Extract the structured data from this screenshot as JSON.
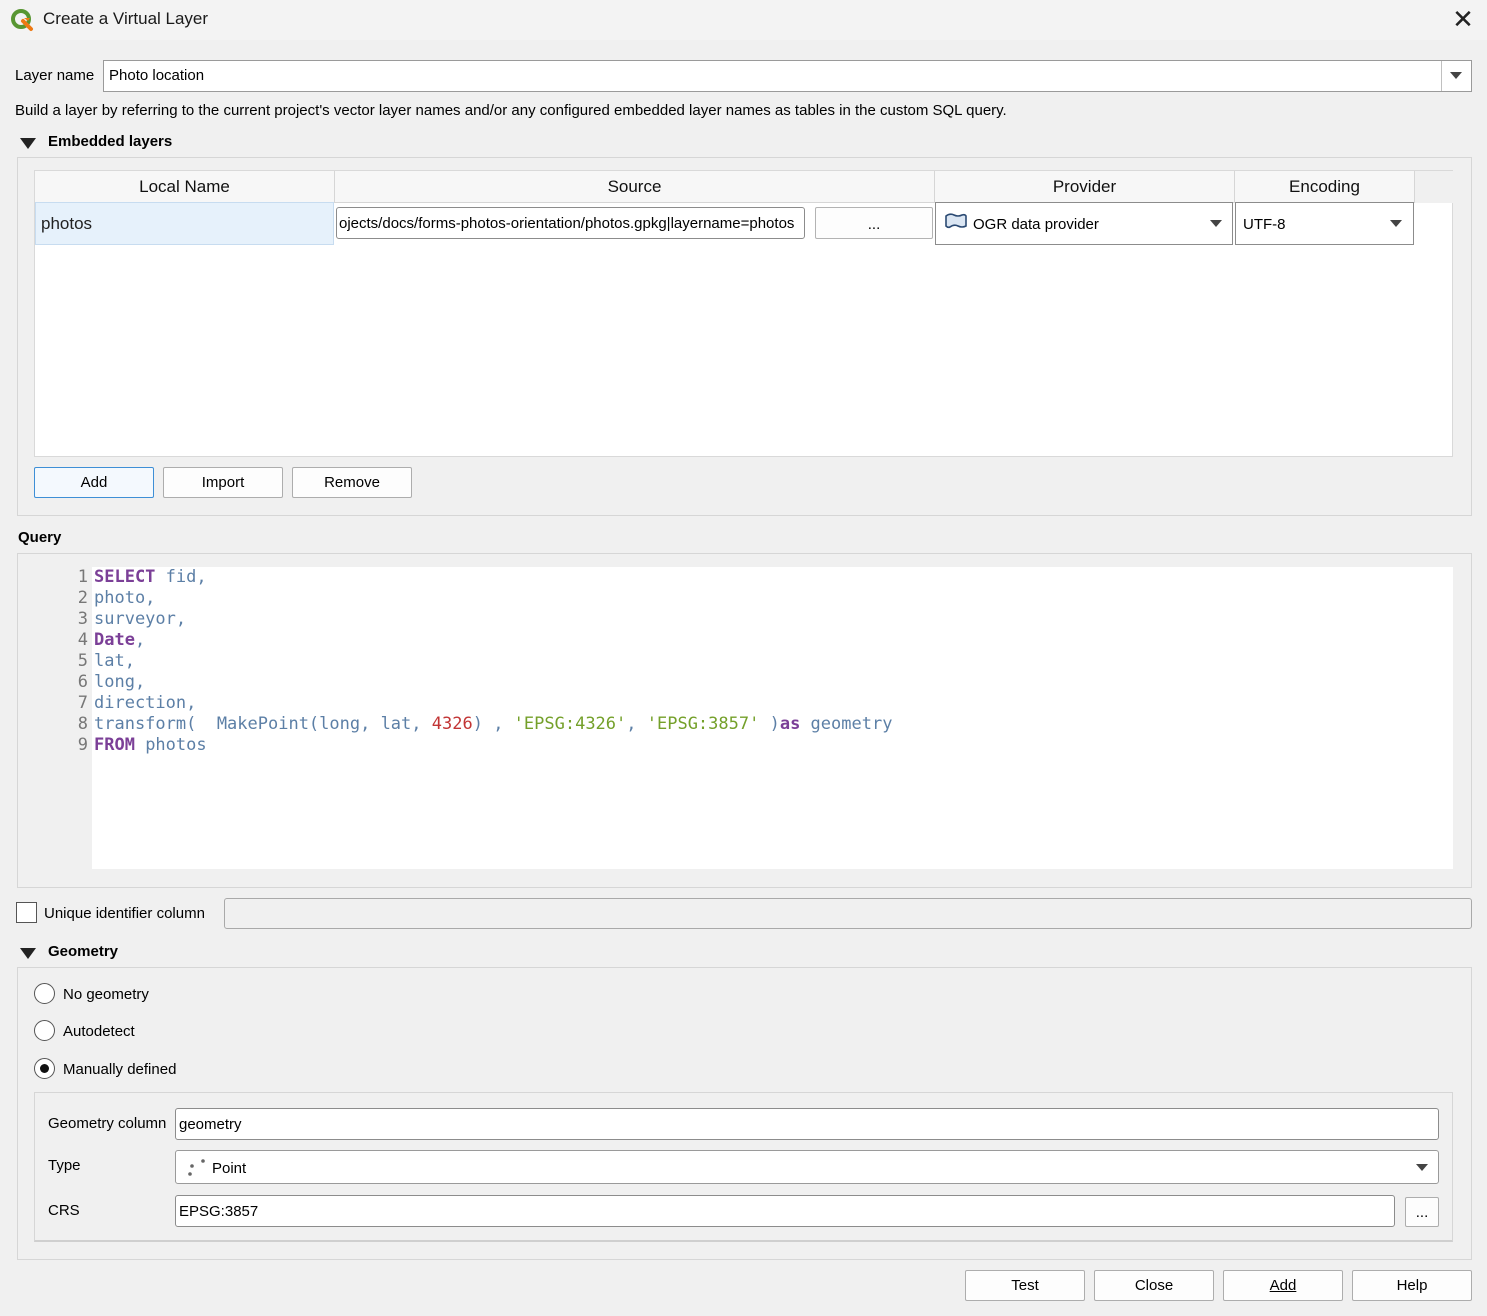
{
  "window": {
    "title": "Create a Virtual Layer",
    "close_symbol": "✕"
  },
  "layer_name": {
    "label": "Layer name",
    "value": "Photo location"
  },
  "description": "Build a layer by referring to the current project's vector layer names and/or any configured embedded layer names as tables in the custom SQL query.",
  "embedded_layers": {
    "title": "Embedded layers",
    "columns": [
      "Local Name",
      "Source",
      "Provider",
      "Encoding"
    ],
    "rows": [
      {
        "local_name": "photos",
        "source": "ojects/docs/forms-photos-orientation/photos.gpkg|layername=photos",
        "browse_label": "...",
        "provider": "OGR data provider",
        "encoding": "UTF-8"
      }
    ],
    "buttons": {
      "add": "Add",
      "import": "Import",
      "remove": "Remove"
    }
  },
  "query": {
    "title": "Query",
    "line_numbers": [
      "1",
      "2",
      "3",
      "4",
      "5",
      "6",
      "7",
      "8",
      "9"
    ],
    "tokens": {
      "l1_kw": "SELECT",
      "l1_rest": " fid,",
      "l2": "photo,",
      "l3": "surveyor,",
      "l4_kw": "Date",
      "l4_rest": ",",
      "l5": "lat,",
      "l6": "long,",
      "l7": "direction,",
      "l8_a": "transform(  MakePoint(long, lat, ",
      "l8_num": "4326",
      "l8_b": ") , ",
      "l8_str1": "'EPSG:4326'",
      "l8_c": ", ",
      "l8_str2": "'EPSG:3857'",
      "l8_d": " )",
      "l8_kw": "as",
      "l8_e": " geometry",
      "l9_kw": "FROM",
      "l9_rest": " photos"
    }
  },
  "unique_identifier": {
    "label": "Unique identifier column",
    "checked": false,
    "value": ""
  },
  "geometry": {
    "title": "Geometry",
    "options": {
      "none": "No geometry",
      "auto": "Autodetect",
      "manual": "Manually defined"
    },
    "selected": "manual",
    "column_label": "Geometry column",
    "column_value": "geometry",
    "type_label": "Type",
    "type_value": "Point",
    "crs_label": "CRS",
    "crs_value": "EPSG:3857",
    "crs_button": "..."
  },
  "footer": {
    "test": "Test",
    "close": "Close",
    "add": "Add",
    "help": "Help"
  },
  "colors": {
    "keyword": "#7b3f97",
    "identifier": "#5c7fa6",
    "number": "#c23535",
    "string": "#74a02a",
    "qgis_green": "#589632",
    "qgis_yellow": "#ee7913"
  },
  "icons": {
    "app": "qgis-logo-icon",
    "provider": "ogr-provider-icon",
    "type": "point-geometry-icon",
    "close": "close-icon",
    "dropdown": "chevron-down-icon"
  }
}
